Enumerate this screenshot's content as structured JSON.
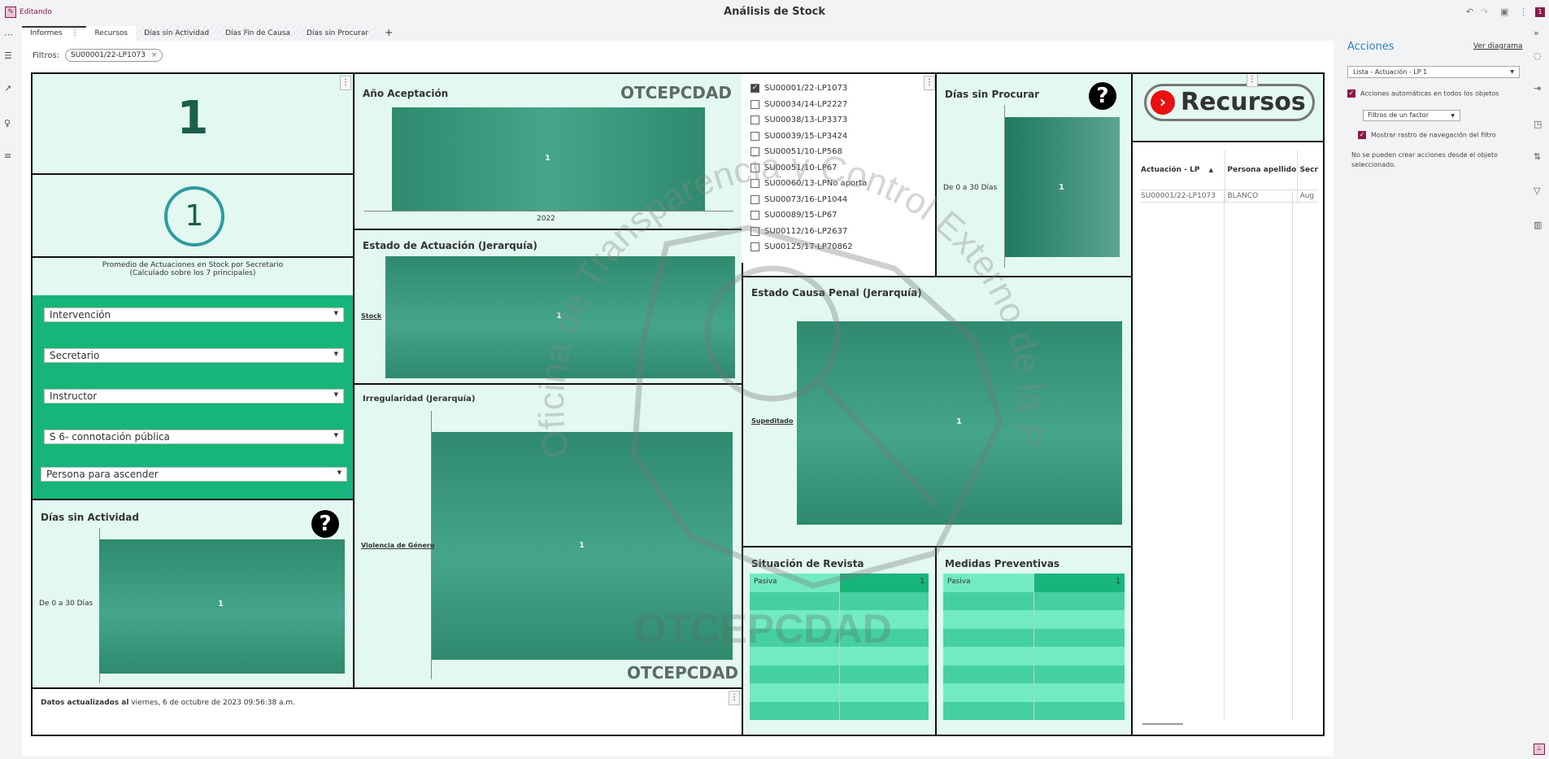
{
  "topbar": {
    "mode": "Editando",
    "title": "Análisis de Stock",
    "badge": "1"
  },
  "tabs": [
    {
      "label": "Informes"
    },
    {
      "label": "Recursos"
    },
    {
      "label": "Días sin Actividad"
    },
    {
      "label": "Días Fin de Causa"
    },
    {
      "label": "Días sin Procurar"
    }
  ],
  "add_tab": "+",
  "filters": {
    "label": "Filtros:",
    "chip": "SU00001/22-LP1073",
    "chip_close": "×"
  },
  "kpi": {
    "total": "1",
    "avg": "1",
    "avg_caption_1": "Promedio de Actuaciones en Stock por Secretario",
    "avg_caption_2": "(Calculado sobre los 7 principales)"
  },
  "selectors": [
    {
      "value": "Intervención"
    },
    {
      "value": "Secretario"
    },
    {
      "value": "Instructor"
    },
    {
      "value": "S 6- connotación pública"
    },
    {
      "value": "Persona para ascender"
    }
  ],
  "charts": {
    "dias_actividad": {
      "title": "Días sin Actividad",
      "category": "De 0 a 30 Días",
      "value": "1"
    },
    "anio": {
      "title": "Año Aceptación",
      "category": "2022",
      "value": "1",
      "brand": "OTCEPCDAD"
    },
    "estado_actuacion": {
      "title": "Estado de Actuación (Jerarquía)",
      "category": "Stock",
      "value": "1"
    },
    "irregularidad": {
      "title": "Irregularidad (Jerarquía)",
      "category": "Violencia de Género",
      "value": "1",
      "brand": "OTCEPCDAD"
    },
    "dias_procurar": {
      "title": "Días sin Procurar",
      "category": "De 0 a 30 Días",
      "value": "1"
    },
    "causa_penal": {
      "title": "Estado Causa Penal (Jerarquía)",
      "category": "Supeditado",
      "value": "1"
    }
  },
  "checklist": [
    {
      "label": "SU00001/22-LP1073",
      "checked": true
    },
    {
      "label": "SU00034/14-LP2227"
    },
    {
      "label": "SU00038/13-LP3373"
    },
    {
      "label": "SU00039/15-LP3424"
    },
    {
      "label": "SU00051/10-LP568"
    },
    {
      "label": "SU00051/10-LP67"
    },
    {
      "label": "SU00060/13-LPNo aporta"
    },
    {
      "label": "SU00073/16-LP1044"
    },
    {
      "label": "SU00089/15-LP67"
    },
    {
      "label": "SU00112/16-LP2637"
    },
    {
      "label": "SU00125/17-LP70862"
    }
  ],
  "revista": {
    "title": "Situación de Revista",
    "row_label": "Pasiva",
    "row_value": "1"
  },
  "medidas": {
    "title": "Medidas Preventivas",
    "row_label": "Pasiva",
    "row_value": "1"
  },
  "recursos_button": "Recursos",
  "table": {
    "headers": [
      "Actuación -  LP",
      "Persona  apellido",
      "Secr"
    ],
    "rows": [
      [
        "SU00001/22-LP1073",
        "BLANCO",
        "Aug"
      ]
    ]
  },
  "footer": {
    "bold": "Datos actualizados al",
    "text": " viernes, 6 de octubre de 2023 09:56:38 a.m."
  },
  "actions": {
    "title": "Acciones",
    "link": "Ver diagrama",
    "select": "Lista - Actuación - LP 1",
    "auto": "Acciones automáticas en todos los objetos",
    "filter_type": "Filtros de un factor",
    "trail": "Mostrar rastro de navegación del filtro",
    "note": "No se pueden crear acciones desde el objeto seleccionado."
  },
  "watermark": {
    "text": "Oficina de Transparencia y Control Externo de la Policía de la Ciudad",
    "brand": "OTCEPCDAD"
  },
  "colors": {
    "accent": "#8a1a4b",
    "panel": "#e2f8f0",
    "filters_bg": "#17b57a",
    "bar": "#3a9a7e"
  }
}
